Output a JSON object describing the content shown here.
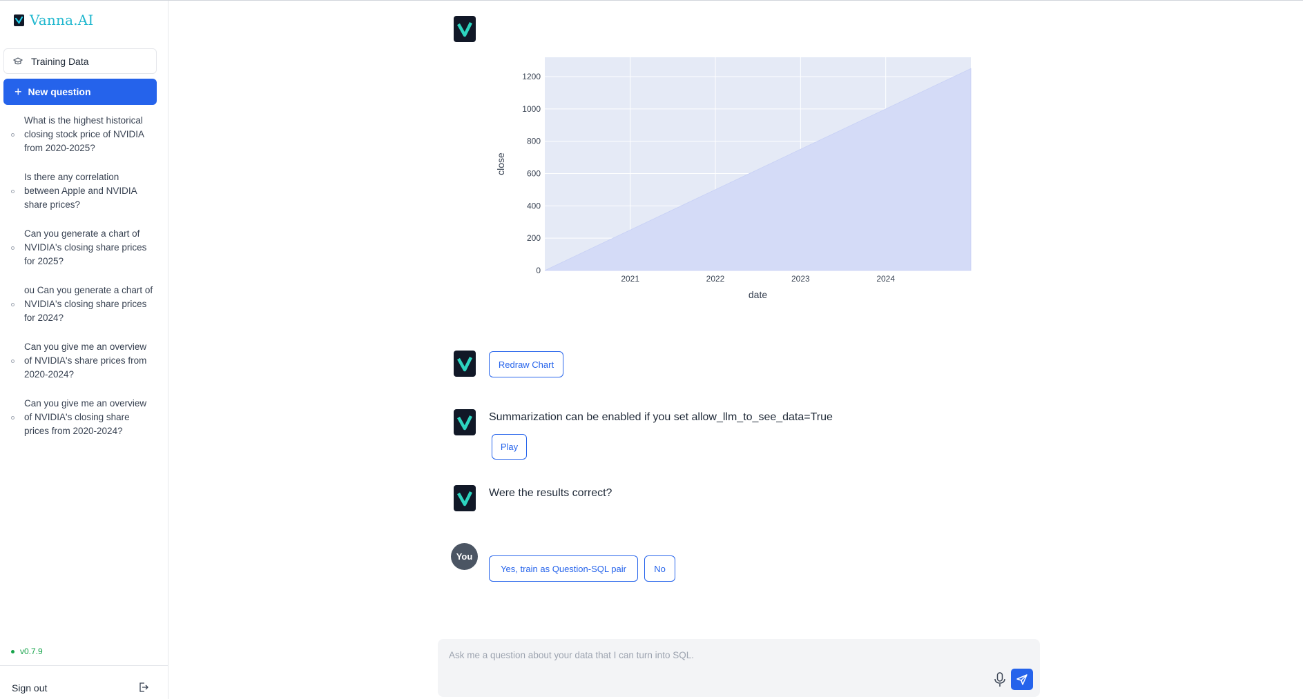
{
  "app": {
    "title": "Vanna.AI",
    "version": "v0.7.9"
  },
  "sidebar": {
    "training_label": "Training Data",
    "new_question_label": "New question",
    "questions": [
      "What is the highest historical closing stock price of NVIDIA from 2020-2025?",
      "Is there any correlation between Apple and NVIDIA share prices?",
      "Can you generate a chart of NVIDIA's closing share prices for 2025?",
      "ou Can you generate a chart of NVIDIA's closing share prices for 2024?",
      "Can you give me an overview of NVIDIA's share prices from 2020-2024?",
      "Can you give me an overview of NVIDIA's closing share prices from 2020-2024?"
    ],
    "sign_out_label": "Sign out"
  },
  "chat": {
    "redraw_label": "Redraw Chart",
    "summary_text": "Summarization can be enabled if you set allow_llm_to_see_data=True",
    "play_label": "Play",
    "feedback_question": "Were the results correct?",
    "you_label": "You",
    "yes_label": "Yes, train as Question-SQL pair",
    "no_label": "No"
  },
  "input": {
    "placeholder": "Ask me a question about your data that I can turn into SQL."
  },
  "colors": {
    "accent": "#2563eb",
    "brand": "#22b8cf",
    "bot_avatar_bg": "#111827",
    "chart_fill": "#d4dbf7",
    "plot_bg": "#e5eaf6"
  },
  "chart_data": {
    "type": "area",
    "xlabel": "date",
    "ylabel": "close",
    "x_start": "2020-01-01",
    "x_end": "2024-12-31",
    "x_ticks": [
      "2021",
      "2022",
      "2023",
      "2024"
    ],
    "y_ticks": [
      0,
      200,
      400,
      600,
      800,
      1000,
      1200
    ],
    "ylim": [
      0,
      1320
    ],
    "points": [
      {
        "x": "2020-01-01",
        "y": 0
      },
      {
        "x": "2024-12-31",
        "y": 1250
      }
    ],
    "grid": true
  }
}
